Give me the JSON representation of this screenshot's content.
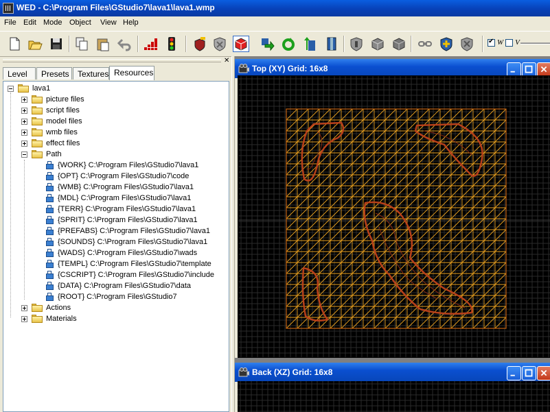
{
  "window": {
    "title": "WED - C:\\Program Files\\GStudio7\\lava1\\lava1.wmp"
  },
  "menu": [
    "File",
    "Edit",
    "Mode",
    "Object",
    "View",
    "Help"
  ],
  "toolbar": {
    "buttons": [
      "new-icon",
      "open-icon",
      "save-icon",
      "copy-icon",
      "paste-icon",
      "undo-icon",
      "build-icon",
      "run-icon",
      "add-position-icon",
      "select-icon",
      "cube-icon",
      "move-icon",
      "rotate-icon",
      "scale-icon",
      "dock-icon",
      "shield-icon",
      "block-icon",
      "block2-icon",
      "block3-icon",
      "link-icon",
      "add-object-icon",
      "delete-object-icon"
    ],
    "checks": [
      {
        "label": "W",
        "checked": true
      },
      {
        "label": "V",
        "checked": false
      }
    ]
  },
  "left_panel": {
    "tabs": [
      "Level",
      "Presets",
      "Textures",
      "Resources"
    ],
    "active_tab": "Resources",
    "tree": {
      "root": "lava1",
      "folders": [
        "picture files",
        "script files",
        "model files",
        "wmb files",
        "effect files"
      ],
      "path_folder": "Path",
      "paths": [
        "{WORK} C:\\Program Files\\GStudio7\\lava1",
        "{OPT} C:\\Program Files\\GStudio7\\code",
        "{WMB} C:\\Program Files\\GStudio7\\lava1",
        "{MDL} C:\\Program Files\\GStudio7\\lava1",
        "{TERR} C:\\Program Files\\GStudio7\\lava1",
        "{SPRIT} C:\\Program Files\\GStudio7\\lava1",
        "{PREFABS} C:\\Program Files\\GStudio7\\lava1",
        "{SOUNDS} C:\\Program Files\\GStudio7\\lava1",
        "{WADS} C:\\Program Files\\GStudio7\\wads",
        "{TEMPL} C:\\Program Files\\GStudio7\\template",
        "{CSCRIPT} C:\\Program Files\\GStudio7\\include",
        "{DATA} C:\\Program Files\\GStudio7\\data",
        "{ROOT} C:\\Program Files\\GStudio7"
      ],
      "after": [
        "Actions",
        "Materials"
      ]
    }
  },
  "views": {
    "top": {
      "title": "Top (XY) Grid: 16x8"
    },
    "back": {
      "title": "Back (XZ) Grid: 16x8"
    }
  },
  "colors": {
    "grid": "#2a2a2a",
    "mesh": "#e8a020",
    "lava": "#b8401a",
    "title_blue": "#0a4fd0"
  }
}
